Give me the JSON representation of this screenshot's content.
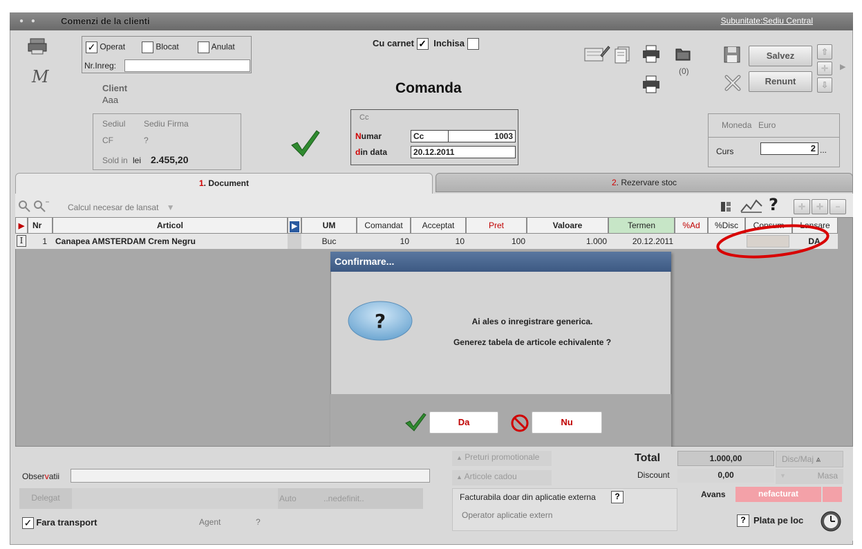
{
  "window": {
    "title": "Comenzi de la clienti",
    "subunit": "Subunitate:Sediu Central"
  },
  "header": {
    "operat_label": "Operat",
    "operat_checked": true,
    "blocat_label": "Blocat",
    "anulat_label": "Anulat",
    "nr_inreg_label": "Nr.Inreg:",
    "nr_inreg_value": "",
    "client_label": "Client",
    "client_value": "Aaa",
    "cu_carnet_label": "Cu carnet",
    "cu_carnet_checked": true,
    "inchisa_label": "Inchisa",
    "doc_title": "Comanda",
    "badge_count": "(0)",
    "save_label": "Salvez",
    "cancel_label": "Renunt"
  },
  "client_box": {
    "sediul_label": "Sediul",
    "sediul_value": "Sediu Firma",
    "cf_label": "CF",
    "cf_value": "?",
    "sold_label": "Sold in",
    "sold_currency": "lei",
    "sold_value": "2.455,20"
  },
  "doc_box": {
    "series_hint": "Cc",
    "numar_label_first": "N",
    "numar_label_rest": "umar",
    "numar_series": "Cc",
    "numar_value": "1003",
    "data_label_first": "d",
    "data_label_rest": "in data",
    "data_value": "20.12.2011"
  },
  "currency_box": {
    "moneda_label": "Moneda",
    "moneda_value": "Euro",
    "curs_label": "Curs",
    "curs_value": "2",
    "curs_more": "..."
  },
  "tabs": [
    {
      "num": "1",
      "label": ". Document"
    },
    {
      "num": "2",
      "label": ". Rezervare stoc"
    }
  ],
  "toolbar": {
    "calc_label": "Calcul necesar de lansat"
  },
  "grid": {
    "columns": [
      "Nr",
      "Articol",
      "UM",
      "Comandat",
      "Acceptat",
      "Pret",
      "Valoare",
      "Termen",
      "%Ad",
      "%Disc",
      "Consum",
      "Lansare"
    ],
    "rows": [
      {
        "nr": "1",
        "articol": "Canapea AMSTERDAM Crem Negru",
        "um": "Buc",
        "comandat": "10",
        "acceptat": "10",
        "pret": "100",
        "valoare": "1.000",
        "termen": "20.12.2011",
        "ad": "",
        "disc": "",
        "consum": "",
        "lansare": "DA"
      }
    ]
  },
  "dialog": {
    "title": "Confirmare...",
    "line1": "Ai ales o inregistrare generica.",
    "line2": "Generez tabela de articole echivalente ?",
    "yes_label": "Da",
    "no_label": "Nu"
  },
  "footer": {
    "preturi_label": "Preturi promotionale",
    "cadou_label": "Articole cadou",
    "facturabila_label": "Facturabila doar din aplicatie externa",
    "facturabila_q": "?",
    "operator_label": "Operator aplicatie extern",
    "total_label": "Total",
    "total_value": "1.000,00",
    "disc_maj_label": "Disc/Maj",
    "discount_label": "Discount",
    "discount_value": "0,00",
    "masa_label": "Masa",
    "avans_label": "Avans",
    "avans_value": "nefacturat",
    "plata_q": "?",
    "plata_label": "Plata pe loc",
    "observatii_prefix": "Obser",
    "observatii_mid": "v",
    "observatii_suffix": "atii",
    "delegat_label": "Delegat",
    "auto_label": "Auto",
    "auto_value": "..nedefinit..",
    "fara_transport_label": "Fara transport",
    "fara_transport_checked": true,
    "agent_label": "Agent",
    "agent_value": "?"
  }
}
